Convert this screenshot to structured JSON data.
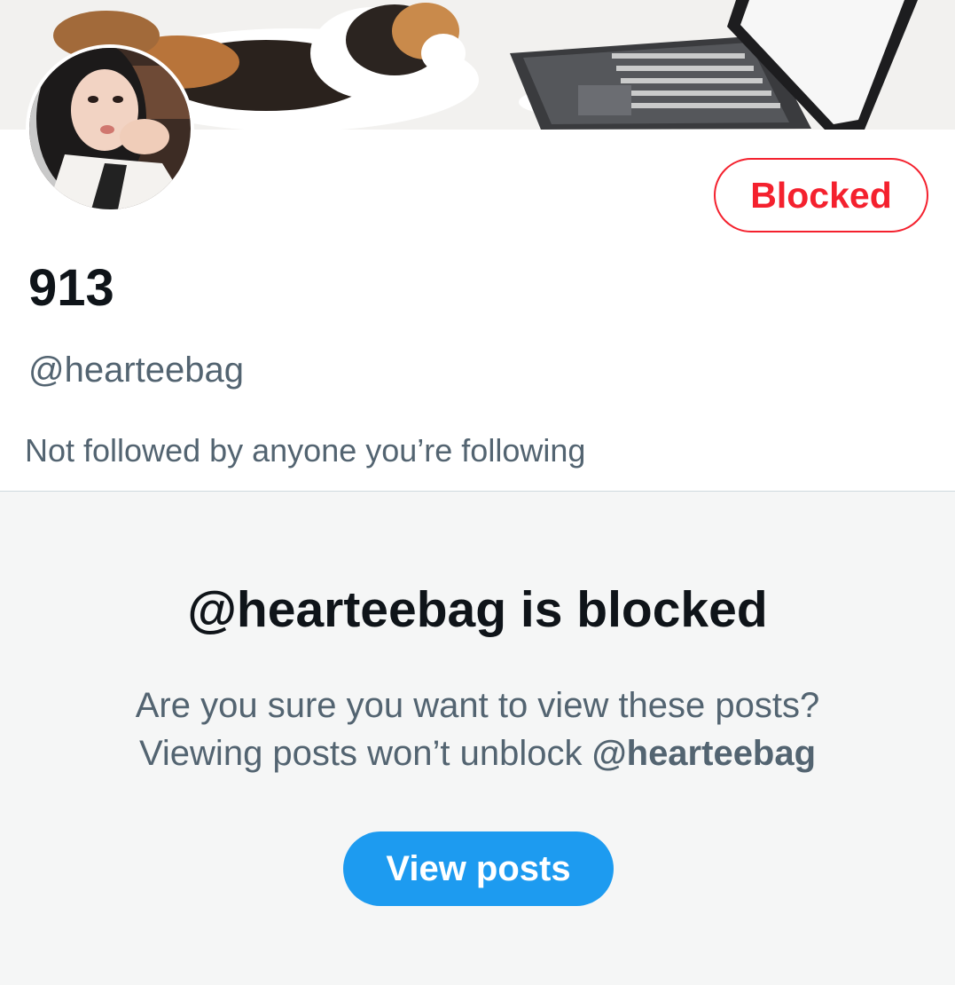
{
  "profile": {
    "display_name": "913",
    "handle": "@hearteebag",
    "followers_context": "Not followed by anyone you’re following",
    "relationship_button": "Blocked"
  },
  "blocked_notice": {
    "title": "@hearteebag is blocked",
    "line1": "Are you sure you want to view these posts?",
    "line2_prefix": "Viewing posts won’t unblock ",
    "line2_handle": "@hearteebag",
    "action_label": "View posts"
  },
  "colors": {
    "accent": "#1d9bf0",
    "danger": "#f4212e",
    "text_primary": "#0f1419",
    "text_secondary": "#536471",
    "panel_background": "#f5f6f6"
  }
}
